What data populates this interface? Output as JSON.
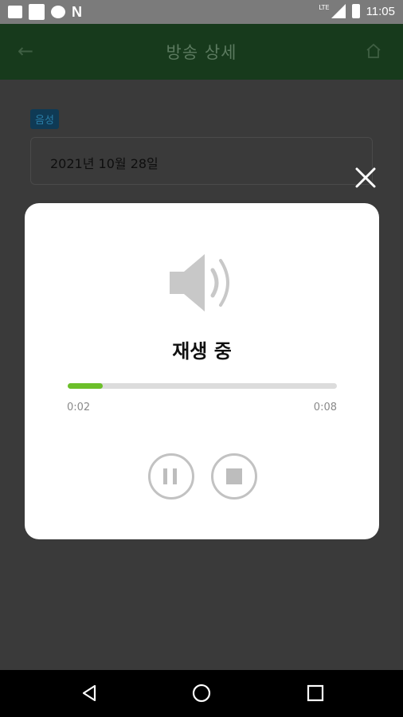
{
  "status_bar": {
    "time": "11:05",
    "network": "LTE",
    "left_icons": [
      "notification-icon",
      "square-icon",
      "search-icon",
      "n-icon"
    ],
    "n_glyph": "N"
  },
  "header": {
    "title": "방송 상세",
    "back_icon": "arrow-left-icon",
    "home_icon": "home-icon",
    "background_color": "#173a1c"
  },
  "content": {
    "tag": "음성",
    "date": "2021년 10월 28일"
  },
  "player_dialog": {
    "status": "재생 중",
    "elapsed": "0:02",
    "duration": "0:08",
    "progress": 0.13,
    "progress_color": "#6cbf2a",
    "icons": [
      "speaker-icon",
      "pause-icon",
      "stop-icon",
      "close-icon"
    ]
  },
  "nav_bar": {
    "icons": [
      "nav-back-icon",
      "nav-home-icon",
      "nav-recents-icon"
    ]
  },
  "glyphs": {
    "back_arrow": "←"
  }
}
